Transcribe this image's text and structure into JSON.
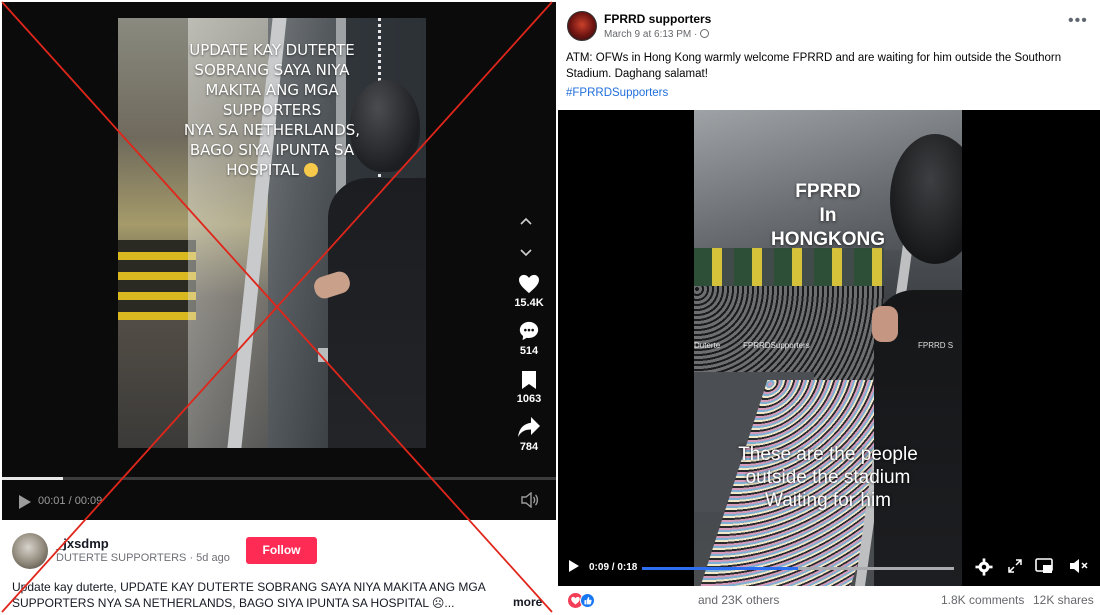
{
  "tiktok": {
    "overlay_text": "UPDATE KAY DUTERTE\nSOBRANG SAYA NIYA\nMAKITA ANG MGA\nSUPPORTERS\nNYA SA NETHERLANDS,\nBAGO SIYA IPUNTA SA\nHOSPITAL",
    "likes": "15.4K",
    "comments": "514",
    "saves": "1063",
    "shares": "784",
    "time": "00:01 / 00:09",
    "progress": 0.11,
    "username": "_jxsdmp",
    "subline": "DUTERTE SUPPORTERS · 5d ago",
    "follow_label": "Follow",
    "caption": "Update kay duterte, UPDATE KAY DUTERTE SOBRANG SAYA NIYA MAKITA ANG MGA SUPPORTERS NYA SA NETHERLANDS, BAGO SIYA IPUNTA SA HOSPITAL ☹...",
    "more_label": "more",
    "accent": "#fe2c55",
    "icons": [
      "chevron-up-icon",
      "chevron-down-icon",
      "heart-icon",
      "comment-icon",
      "bookmark-icon",
      "share-icon",
      "play-icon",
      "volume-icon"
    ]
  },
  "cross_color": "#e0261b",
  "facebook": {
    "page_name": "FPRRD supporters",
    "date": "March 9 at 6:13 PM ·",
    "post_text": "ATM: OFWs in Hong Kong warmly welcome FPRRD and are waiting for him outside the Southorn Stadium. Daghang salamat!",
    "hashtag": "#FPRRDSupporters",
    "video_title": "FPRRD\nIn\nHONGKONG",
    "video_caption": "These are the people\noutside the stadium\nWaiting for him",
    "watermarks": [
      "Duterte",
      "FPRRDSupporters",
      "FPRRD S"
    ],
    "time": "0:09 / 0:18",
    "progress": 0.5,
    "reactions_text": "and 23K others",
    "comments": "1.8K comments",
    "shares": "12K shares",
    "link_color": "#216fdb",
    "progress_color": "#2e6ff2",
    "icons": [
      "more-icon",
      "globe-icon",
      "play-icon",
      "settings-icon",
      "expand-icon",
      "pip-icon",
      "mute-icon",
      "love-reaction-icon",
      "like-reaction-icon"
    ]
  }
}
